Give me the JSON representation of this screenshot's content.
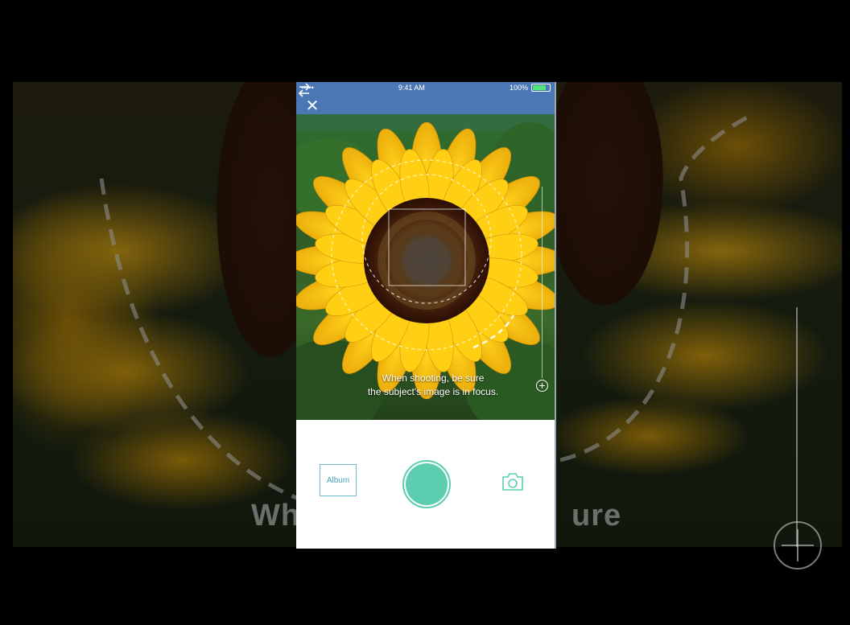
{
  "status_bar": {
    "carrier": "•••••",
    "time": "9:41 AM",
    "battery": "100%"
  },
  "camera": {
    "close_icon": "close-icon",
    "rotate_icon": "rotate-icon",
    "hint_line1": "When shooting, be sure",
    "hint_line2": "the subject's image is in focus.",
    "zoom_icon": "zoom-plus-icon"
  },
  "controls": {
    "album_label": "Album",
    "shutter_icon": "shutter-icon",
    "switch_camera_icon": "camera-icon",
    "accent_color": "#5dcdb0"
  },
  "background": {
    "caption_left": "Wh",
    "caption_right": "ure"
  }
}
